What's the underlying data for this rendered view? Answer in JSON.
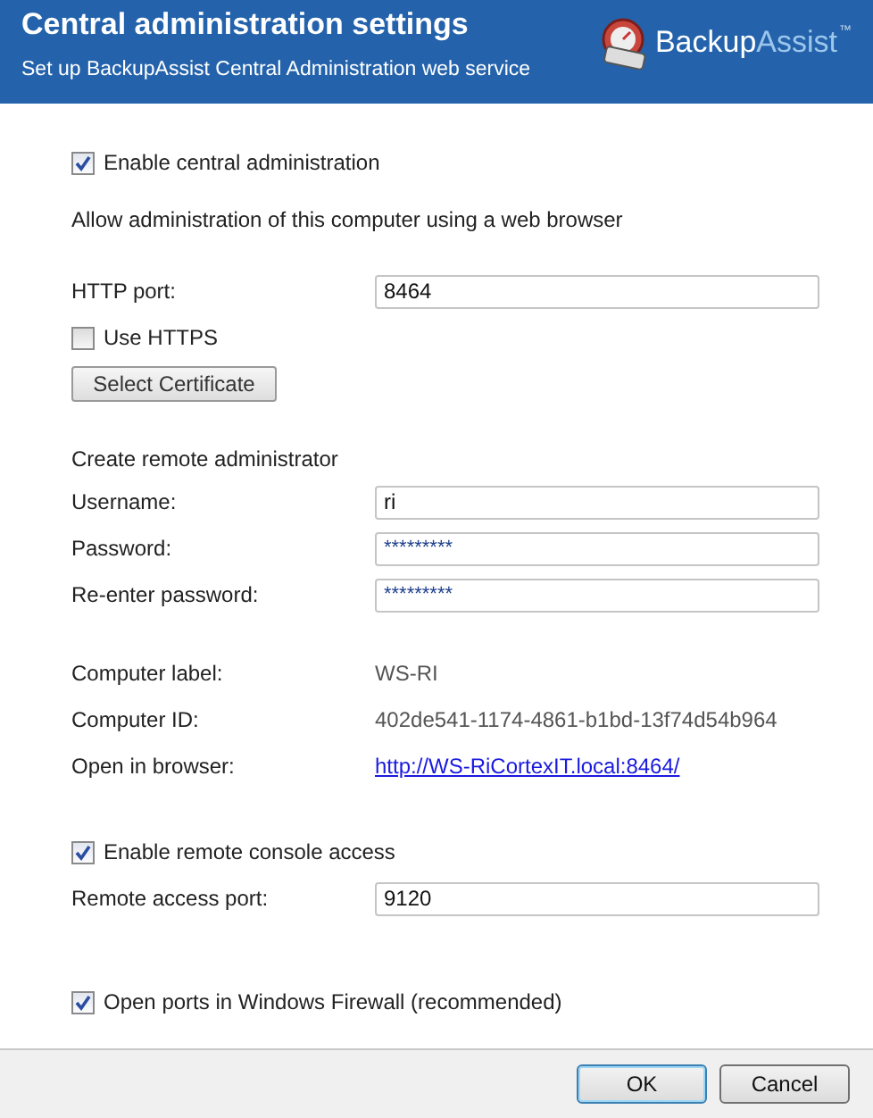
{
  "header": {
    "title": "Central administration settings",
    "subtitle": "Set up BackupAssist Central Administration web service",
    "logo": {
      "words": [
        "Backup",
        "Assist"
      ],
      "mark": "™"
    }
  },
  "sections": [
    {
      "items": [
        {
          "kind": "checkbox",
          "label": "Enable central administration",
          "checked": true
        }
      ]
    },
    {
      "items": [
        {
          "kind": "text",
          "text": "Allow administration of this computer using a web browser"
        }
      ]
    },
    {
      "items": [
        {
          "kind": "field",
          "label": "HTTP port:",
          "value": "8464"
        },
        {
          "kind": "checkbox",
          "label": "Use HTTPS",
          "checked": false
        },
        {
          "kind": "button",
          "label": "Select Certificate"
        }
      ]
    },
    {
      "items": [
        {
          "kind": "text",
          "text": "Create remote administrator"
        },
        {
          "kind": "field",
          "label": "Username:",
          "value": "ri"
        },
        {
          "kind": "password",
          "label": "Password:",
          "value": "*********"
        },
        {
          "kind": "password",
          "label": "Re-enter password:",
          "value": "*********"
        }
      ]
    },
    {
      "items": [
        {
          "kind": "info",
          "label": "Computer label:",
          "value": "WS-RI"
        },
        {
          "kind": "info",
          "label": "Computer ID:",
          "value": "402de541-1174-4861-b1bd-13f74d54b964"
        },
        {
          "kind": "link",
          "label": "Open in browser:",
          "value": "http://WS-RiCortexIT.local:8464/"
        }
      ]
    },
    {
      "items": [
        {
          "kind": "checkbox",
          "label": "Enable remote console access",
          "checked": true
        },
        {
          "kind": "field",
          "label": "Remote access port:",
          "value": "9120"
        }
      ]
    },
    {
      "items": [
        {
          "kind": "checkbox",
          "label": "Open ports in Windows Firewall (recommended)",
          "checked": true
        }
      ]
    }
  ],
  "buttons": [
    "OK",
    "Cancel"
  ]
}
